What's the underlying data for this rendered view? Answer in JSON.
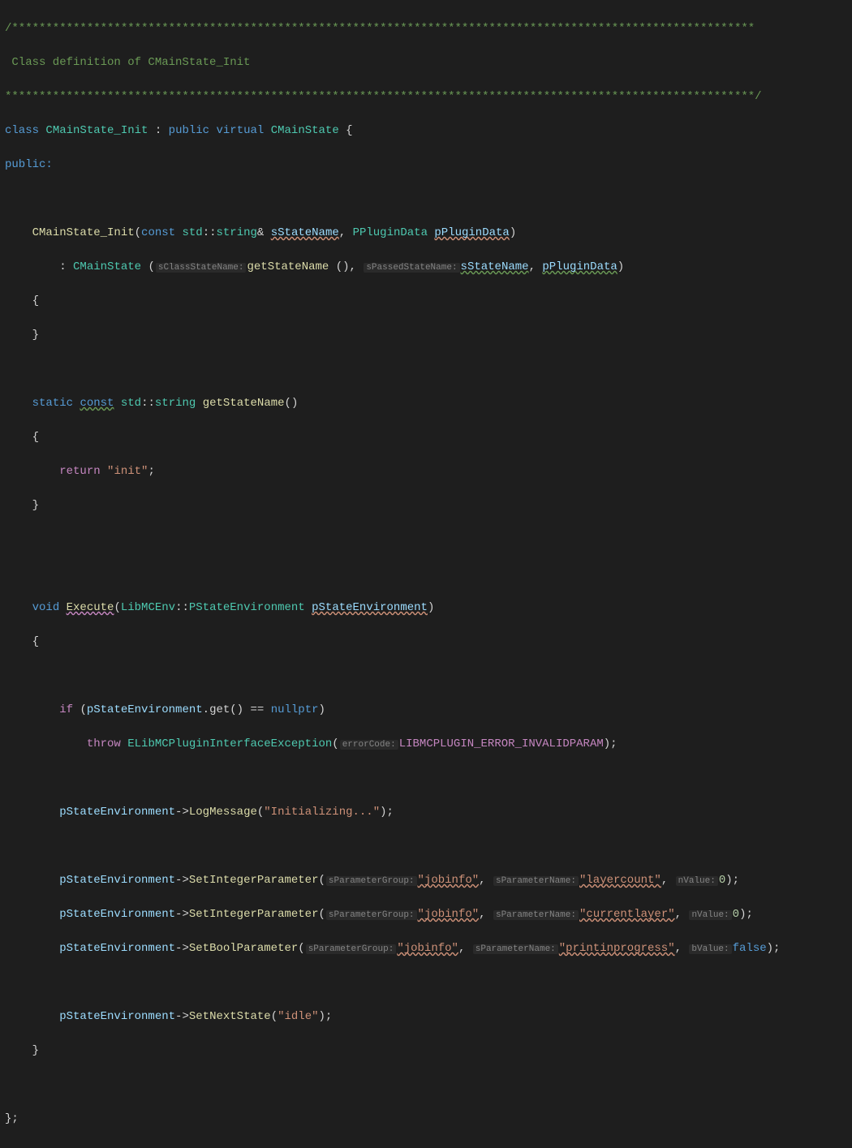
{
  "comment": {
    "stars": "/*************************************************************************************************************",
    "stars_end": "**************************************************************************************************************/",
    "text": " Class definition of CMainState_Init"
  },
  "decl": {
    "class_kw": "class",
    "className": "CMainState_Init",
    "colon": " : ",
    "pub_kw": "public",
    "virt_kw": "virtual",
    "baseClass": "CMainState",
    "open": " {",
    "public_label": "public:"
  },
  "ctor": {
    "name": "CMainState_Init",
    "p1_const": "const",
    "p1_std": "std",
    "p1_string": "string",
    "p1_amp": "& ",
    "p1_name": "sStateName",
    "comma": ", ",
    "p2_type": "PPluginData",
    "p2_name": "pPluginData",
    "init_colon": ": ",
    "base": "CMainState",
    "hint1": "sClassStateName:",
    "getState": "getStateName",
    "hint2": "sPassedStateName:",
    "arg2": "sStateName",
    "arg3": "pPluginData",
    "open": "{",
    "close": "}"
  },
  "get": {
    "static_kw": "static",
    "const_kw": "const",
    "std": "std",
    "string": "string",
    "name": "getStateName",
    "parens": "()",
    "open": "{",
    "return_kw": "return",
    "literal": "\"init\"",
    "semi": ";",
    "close": "}"
  },
  "exec": {
    "void_kw": "void",
    "name": "Execute",
    "ns": "LibMCEnv",
    "ptype": "PStateEnvironment",
    "pname": "pStateEnvironment",
    "open": "{",
    "if_kw": "if",
    "get_call": ".get() == ",
    "nullptr_kw": "nullptr",
    "throw_kw": "throw",
    "exType": "ELibMCPluginInterfaceException",
    "hint_err": "errorCode:",
    "errConst": "LIBMCPLUGIN_ERROR_INVALIDPARAM",
    "log_fn": "LogMessage",
    "log_str": "\"Initializing...\"",
    "setInt_fn": "SetIntegerParameter",
    "setBool_fn": "SetBoolParameter",
    "setNext_fn": "SetNextState",
    "hint_group": "sParameterGroup:",
    "hint_name": "sParameterName:",
    "hint_nval": "nValue:",
    "hint_bval": "bValue:",
    "jobinfo": "\"jobinfo\"",
    "layercount": "\"layercount\"",
    "currentlayer": "\"currentlayer\"",
    "printinprogress": "\"printinprogress\"",
    "zero": "0",
    "false_kw": "false",
    "idle": "\"idle\"",
    "arrow": "->",
    "close": "}"
  },
  "end": "};"
}
